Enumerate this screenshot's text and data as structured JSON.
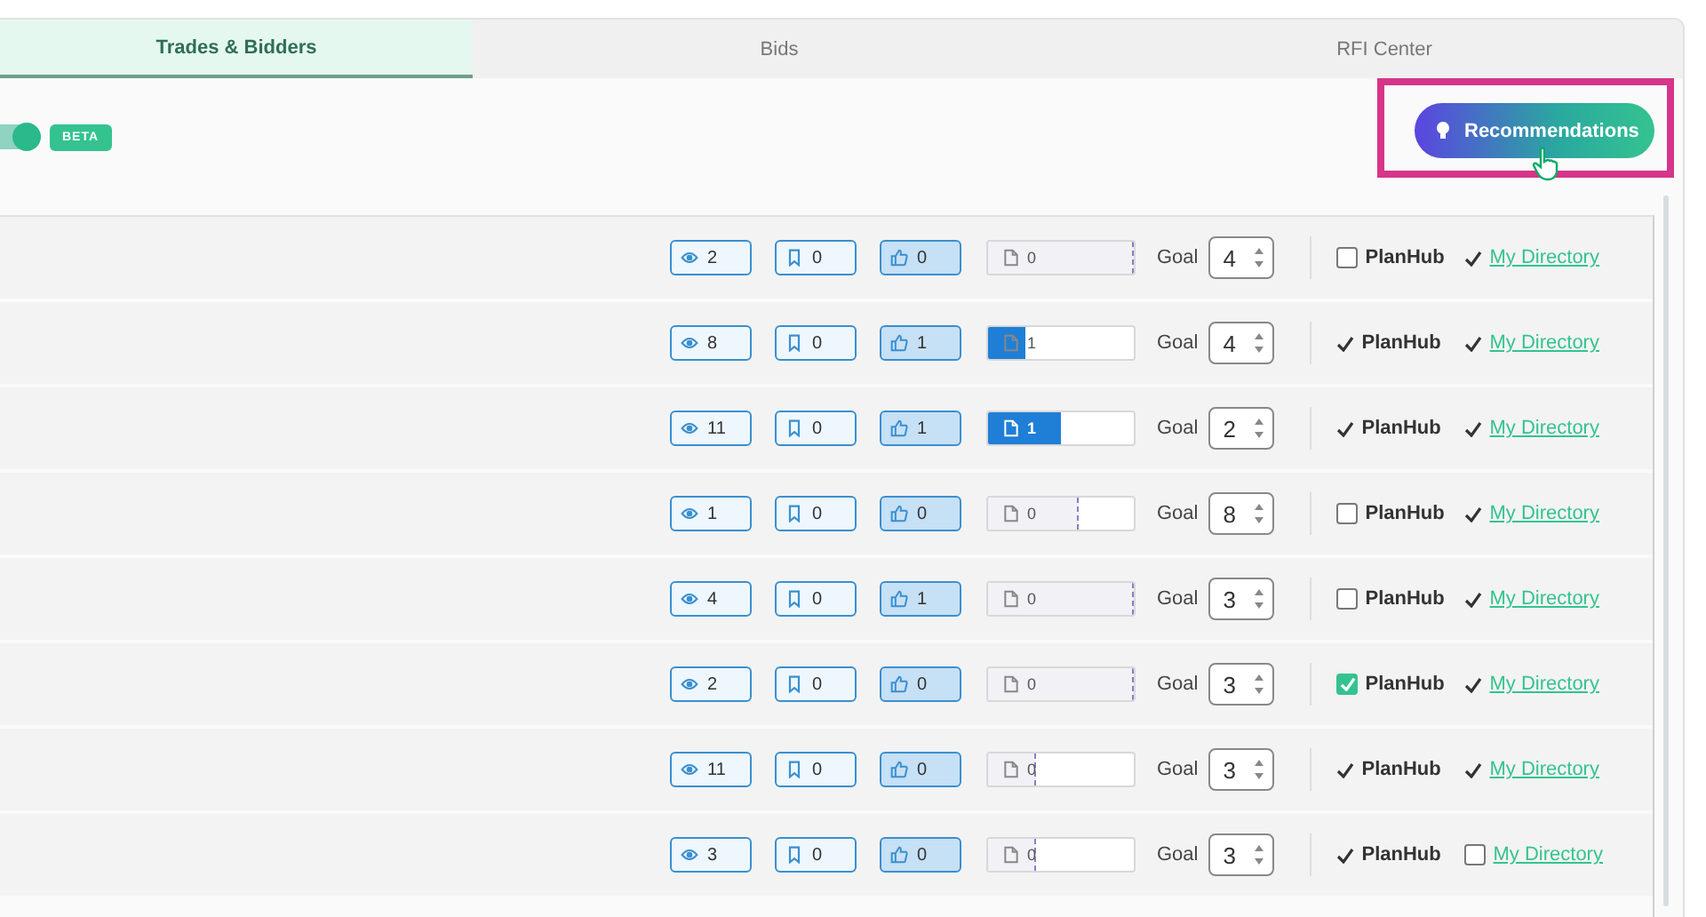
{
  "tabs": [
    {
      "label": "Trades & Bidders",
      "selected": true
    },
    {
      "label": "Bids",
      "selected": false
    },
    {
      "label": "RFI Center",
      "selected": false
    }
  ],
  "toolbar": {
    "toggle": {
      "on": true
    },
    "badge": "BETA",
    "recommendations_button": {
      "label": "Recommendations",
      "highlighted": true
    }
  },
  "rows": [
    {
      "views": "2",
      "saves": "0",
      "likes": "0",
      "bids": {
        "count": "0",
        "level": 0,
        "target": {
          "level": 1
        }
      },
      "goal_label": "Goal",
      "goal": "4",
      "planhub": {
        "kind": "checkbox",
        "checked": false,
        "label": "PlanHub"
      },
      "directory": {
        "kind": "tick",
        "label": "My Directory"
      }
    },
    {
      "views": "8",
      "saves": "0",
      "likes": "1",
      "bids": {
        "count": "1",
        "level": 0.25,
        "target": {
          "level": 0.25
        }
      },
      "goal_label": "Goal",
      "goal": "4",
      "planhub": {
        "kind": "tick",
        "label": "PlanHub"
      },
      "directory": {
        "kind": "tick",
        "label": "My Directory"
      }
    },
    {
      "views": "11",
      "saves": "0",
      "likes": "1",
      "bids": {
        "count": "1",
        "level": 0.5,
        "target": {
          "level": 0.5
        }
      },
      "goal_label": "Goal",
      "goal": "2",
      "planhub": {
        "kind": "tick",
        "label": "PlanHub"
      },
      "directory": {
        "kind": "tick",
        "label": "My Directory"
      }
    },
    {
      "views": "1",
      "saves": "0",
      "likes": "0",
      "bids": {
        "count": "0",
        "level": 0,
        "target": {
          "level": 0.62
        }
      },
      "goal_label": "Goal",
      "goal": "8",
      "planhub": {
        "kind": "checkbox",
        "checked": false,
        "label": "PlanHub"
      },
      "directory": {
        "kind": "tick",
        "label": "My Directory"
      }
    },
    {
      "views": "4",
      "saves": "0",
      "likes": "1",
      "bids": {
        "count": "0",
        "level": 0,
        "target": {
          "level": 1
        }
      },
      "goal_label": "Goal",
      "goal": "3",
      "planhub": {
        "kind": "checkbox",
        "checked": false,
        "label": "PlanHub"
      },
      "directory": {
        "kind": "tick",
        "label": "My Directory"
      }
    },
    {
      "views": "2",
      "saves": "0",
      "likes": "0",
      "bids": {
        "count": "0",
        "level": 0,
        "target": {
          "level": 1
        }
      },
      "goal_label": "Goal",
      "goal": "3",
      "planhub": {
        "kind": "checkbox",
        "checked": true,
        "label": "PlanHub"
      },
      "directory": {
        "kind": "tick",
        "label": "My Directory"
      }
    },
    {
      "views": "11",
      "saves": "0",
      "likes": "0",
      "bids": {
        "count": "0",
        "level": 0,
        "target": {
          "level": 0.33
        }
      },
      "goal_label": "Goal",
      "goal": "3",
      "planhub": {
        "kind": "tick",
        "label": "PlanHub"
      },
      "directory": {
        "kind": "tick",
        "label": "My Directory"
      }
    },
    {
      "views": "3",
      "saves": "0",
      "likes": "0",
      "bids": {
        "count": "0",
        "level": 0,
        "target": {
          "level": 0.33
        }
      },
      "goal_label": "Goal",
      "goal": "3",
      "planhub": {
        "kind": "tick",
        "label": "PlanHub"
      },
      "directory": {
        "kind": "checkbox",
        "checked": false,
        "label": "My Directory"
      }
    }
  ]
}
